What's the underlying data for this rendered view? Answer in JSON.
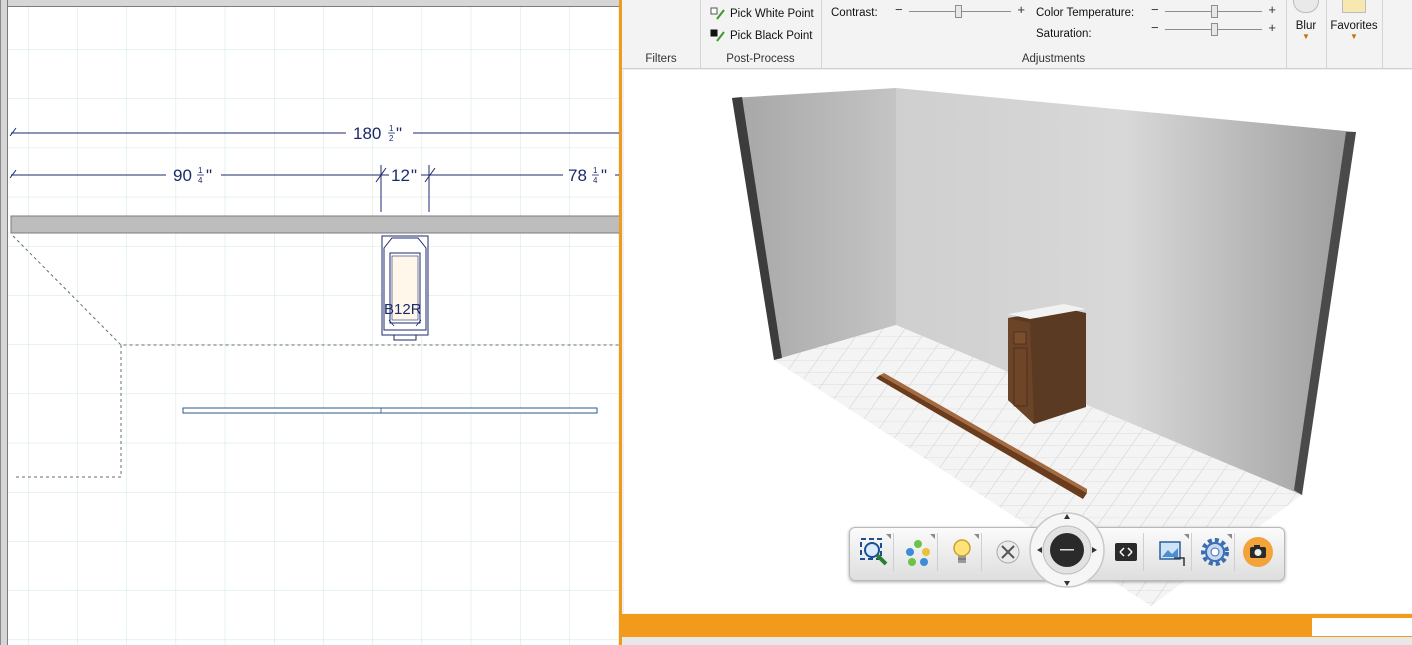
{
  "plan": {
    "dimensions": {
      "overall": {
        "whole": "180",
        "num": "1",
        "den": "2",
        "unit": "\""
      },
      "left": {
        "whole": "90",
        "num": "1",
        "den": "4",
        "unit": "\""
      },
      "middle": {
        "whole": "12",
        "unit": "\""
      },
      "right": {
        "whole": "78",
        "num": "1",
        "den": "4",
        "unit": "\""
      }
    },
    "cabinet_label": "B12R"
  },
  "ribbon": {
    "filters_label": "Filters",
    "post_process": {
      "label": "Post-Process",
      "pick_white_point": "Pick White Point",
      "pick_black_point": "Pick Black Point"
    },
    "adjustments": {
      "label": "Adjustments",
      "contrast": "Contrast:",
      "color_temperature": "Color Temperature:",
      "saturation": "Saturation:",
      "minus": "−",
      "plus": "+"
    },
    "blur": "Blur",
    "favorites": "Favorites"
  },
  "icons": {
    "pick_white": "eyedropper-white-icon",
    "pick_black": "eyedropper-black-icon",
    "zoom_extents": "zoom-extents-icon",
    "color_dots": "material-colors-icon",
    "lightbulb": "lighting-icon",
    "cross": "close-cross-icon",
    "fit": "fit-window-icon",
    "picture": "picture-export-icon",
    "gear": "gear-icon",
    "camera": "camera-icon"
  },
  "colors": {
    "accent": "#f29a1c",
    "dim_text": "#1c2a6b",
    "grid": "#cfe8d3"
  }
}
